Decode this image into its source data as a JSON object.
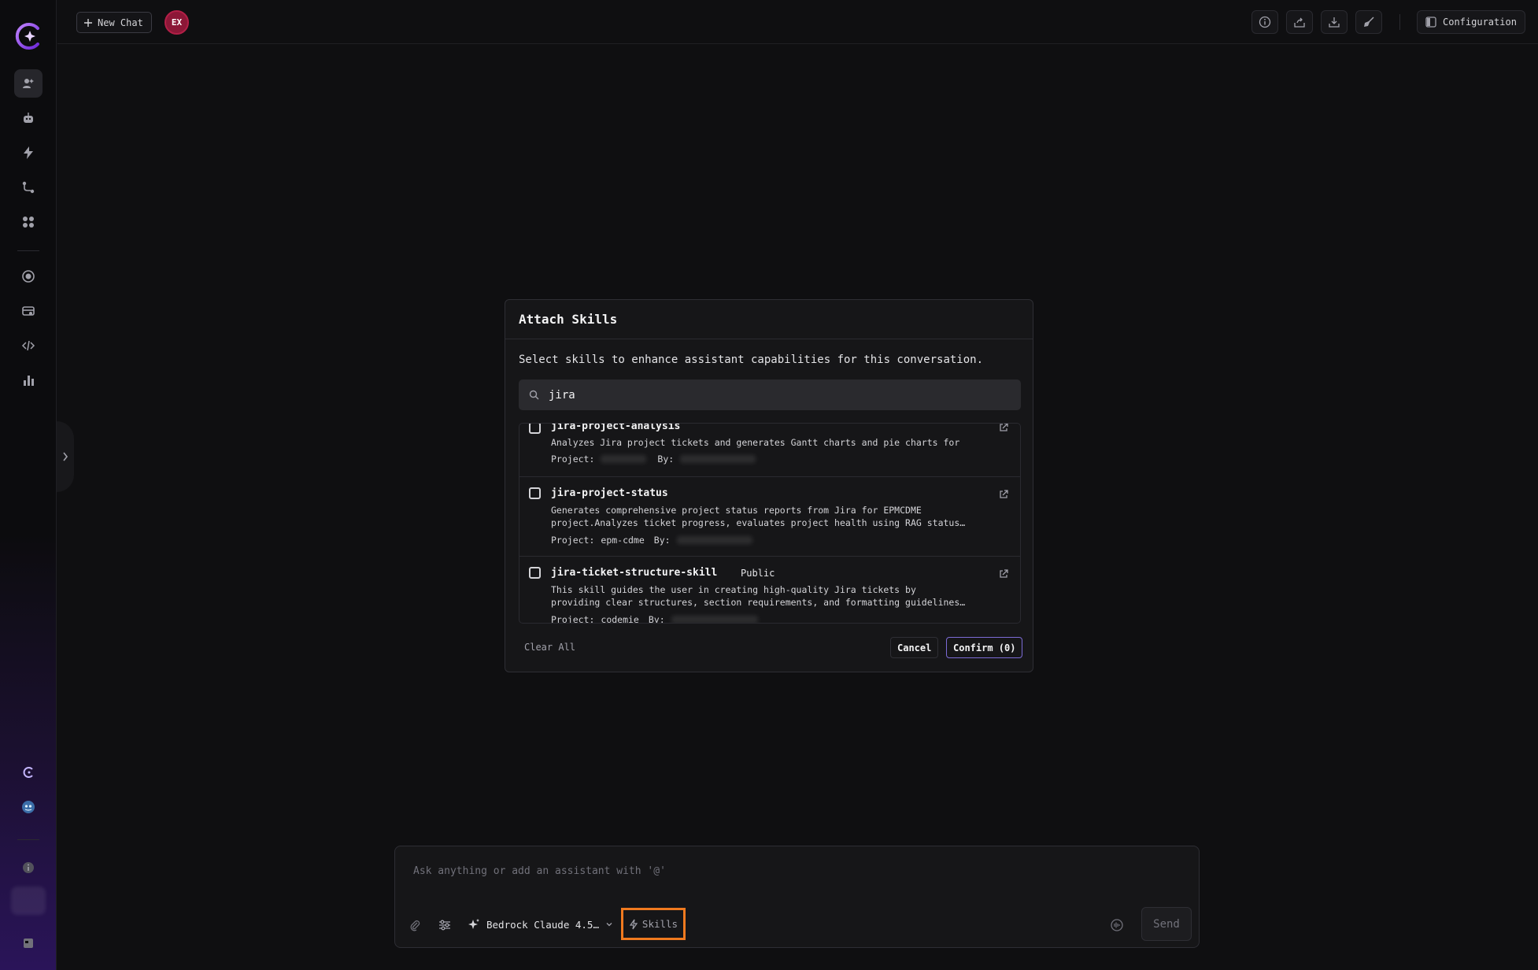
{
  "topbar": {
    "new_chat_label": "New Chat",
    "avatar_initials": "EX",
    "configuration_label": "Configuration"
  },
  "modal": {
    "title": "Attach Skills",
    "description": "Select skills to enhance assistant capabilities for this conversation.",
    "search_value": "jira",
    "clear_all_label": "Clear All",
    "cancel_label": "Cancel",
    "confirm_label": "Confirm (0)",
    "project_prefix": "Project:",
    "by_prefix": "By:",
    "items": [
      {
        "name": "jira-project-analysis",
        "badge": "",
        "desc_line1": "Analyzes Jira project tickets and generates Gantt charts and pie charts for",
        "desc_line2": "",
        "project": "",
        "checked": false
      },
      {
        "name": "jira-project-status",
        "badge": "",
        "desc_line1": "Generates comprehensive project status reports from Jira for EPMCDME",
        "desc_line2": "project.Analyzes ticket progress, evaluates project health using RAG status…",
        "project": "epm-cdme",
        "checked": false
      },
      {
        "name": "jira-ticket-structure-skill",
        "badge": "Public",
        "desc_line1": "This skill guides the user in creating high-quality Jira tickets by",
        "desc_line2": "providing clear structures, section requirements, and formatting guidelines…",
        "project": "codemie",
        "checked": false
      }
    ]
  },
  "composer": {
    "placeholder": "Ask anything or add an assistant with '@'",
    "model_name": "Bedrock Claude 4.5…",
    "skills_label": "Skills",
    "send_label": "Send"
  },
  "colors": {
    "accent_purple": "#7c6bd6",
    "highlight_orange": "#f07a1f",
    "avatar_red": "#8c1737"
  }
}
